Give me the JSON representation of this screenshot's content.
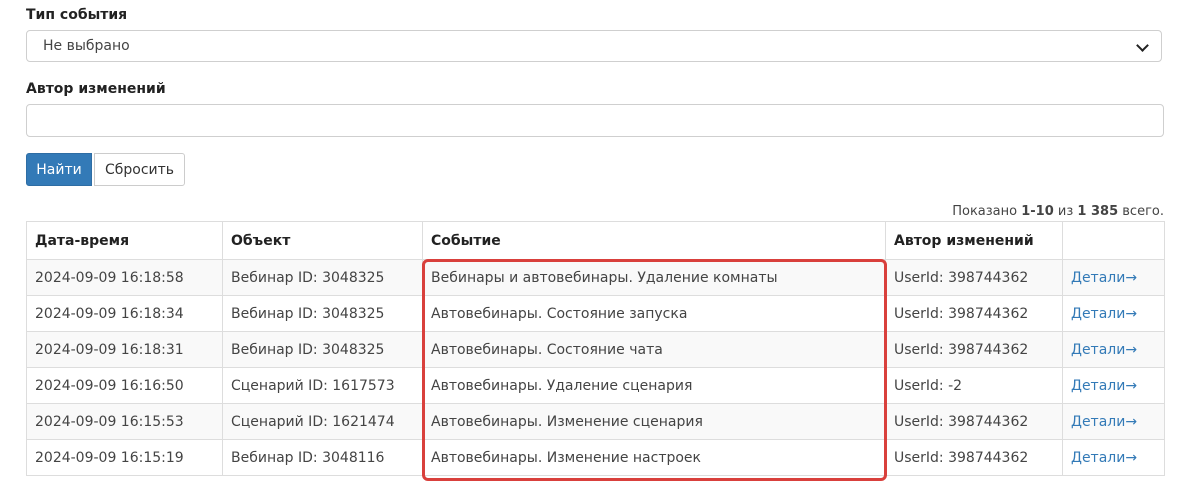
{
  "filters": {
    "event_type_label": "Тип события",
    "event_type_value": "Не выбрано",
    "author_label": "Автор изменений",
    "author_value": "",
    "find_button": "Найти",
    "reset_button": "Сбросить"
  },
  "summary": {
    "prefix": "Показано ",
    "range": "1-10",
    "middle": " из ",
    "total": "1 385",
    "suffix": " всего."
  },
  "table": {
    "headers": [
      "Дата-время",
      "Объект",
      "Событие",
      "Автор изменений",
      ""
    ],
    "rows": [
      {
        "datetime": "2024-09-09 16:18:58",
        "object": "Вебинар ID: 3048325",
        "event": "Вебинары и автовебинары. Удаление комнаты",
        "author": "UserId: 398744362",
        "details": "Детали→"
      },
      {
        "datetime": "2024-09-09 16:18:34",
        "object": "Вебинар ID: 3048325",
        "event": "Автовебинары. Состояние запуска",
        "author": "UserId: 398744362",
        "details": "Детали→"
      },
      {
        "datetime": "2024-09-09 16:18:31",
        "object": "Вебинар ID: 3048325",
        "event": "Автовебинары. Состояние чата",
        "author": "UserId: 398744362",
        "details": "Детали→"
      },
      {
        "datetime": "2024-09-09 16:16:50",
        "object": "Сценарий ID: 1617573",
        "event": "Автовебинары. Удаление сценария",
        "author": "UserId: -2",
        "details": "Детали→"
      },
      {
        "datetime": "2024-09-09 16:15:53",
        "object": "Сценарий ID: 1621474",
        "event": "Автовебинары. Изменение сценария",
        "author": "UserId: 398744362",
        "details": "Детали→"
      },
      {
        "datetime": "2024-09-09 16:15:19",
        "object": "Вебинар ID: 3048116",
        "event": "Автовебинары. Изменение настроек",
        "author": "UserId: 398744362",
        "details": "Детали→"
      }
    ]
  },
  "colors": {
    "primary": "#337ab7",
    "highlight": "#d9403c",
    "link": "#337ab7"
  }
}
